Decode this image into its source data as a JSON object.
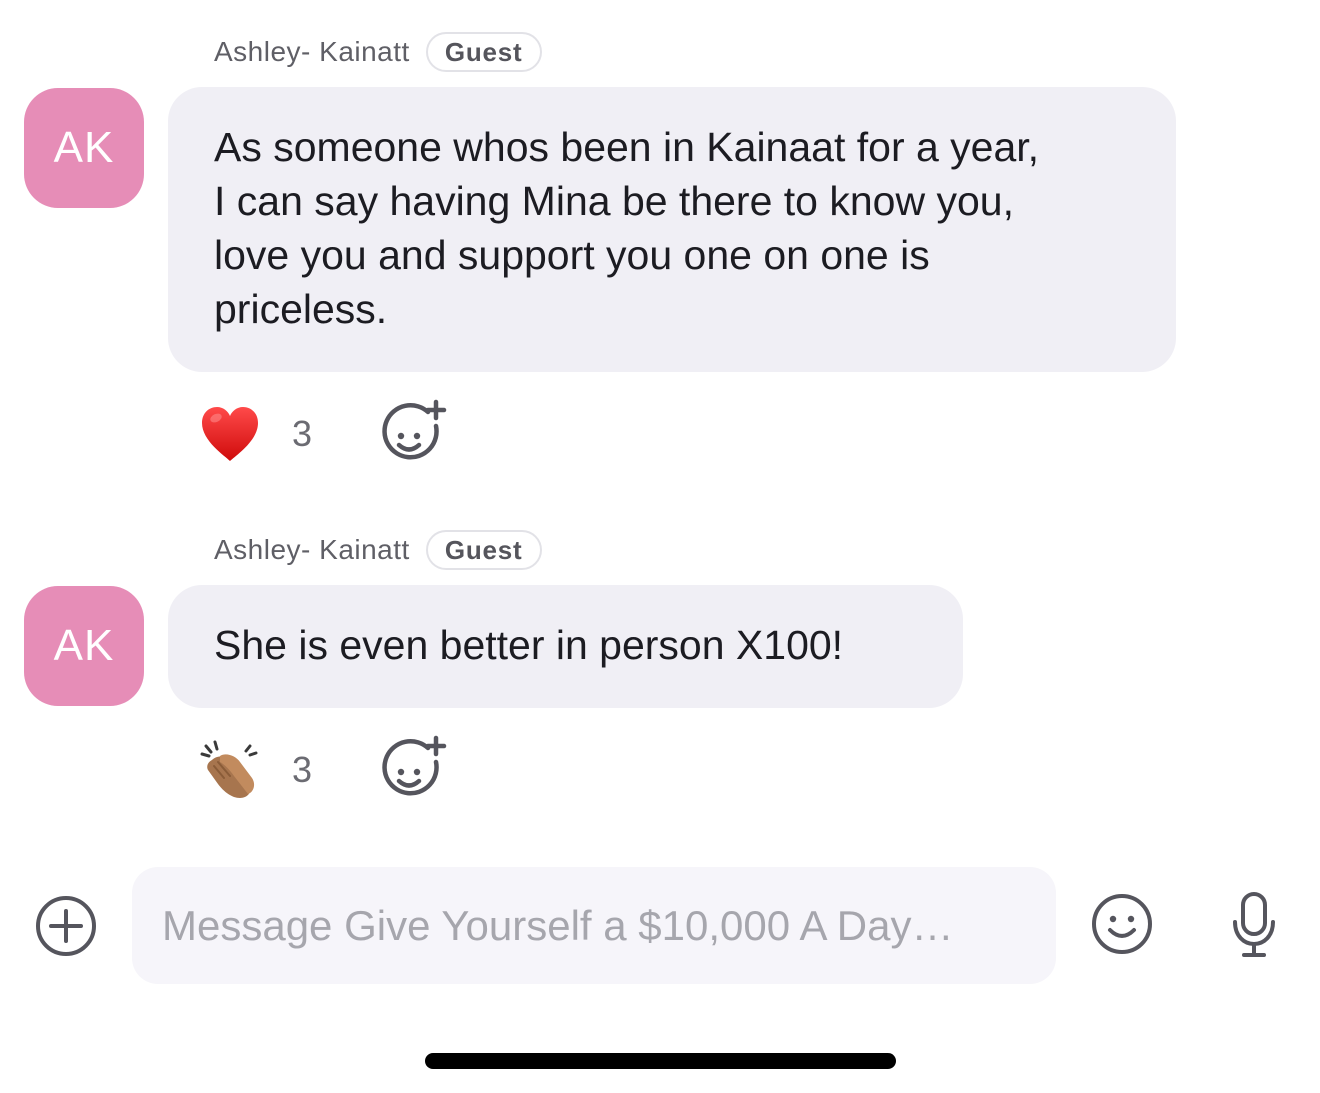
{
  "messages": [
    {
      "sender": "Ashley- Kainatt",
      "badge": "Guest",
      "avatar_initials": "AK",
      "text_lines": [
        "As someone whos been in Kainaat for a year,",
        "I can say having Mina be there to know you,",
        "love you and support you one on one is",
        "priceless."
      ],
      "reaction": {
        "emoji": "heart-emoji",
        "count": "3"
      }
    },
    {
      "sender": "Ashley- Kainatt",
      "badge": "Guest",
      "avatar_initials": "AK",
      "text_lines": [
        "She is even better in person X100!"
      ],
      "reaction": {
        "emoji": "clapping-hands-emoji",
        "count": "3"
      }
    }
  ],
  "composer": {
    "placeholder": "Message Give Yourself a $10,000 A Day…",
    "icons": [
      "plus-circle-icon",
      "smiley-icon",
      "microphone-icon"
    ]
  },
  "colors": {
    "avatar": "#e68db7",
    "bubble": "#f0eff5",
    "composer": "#f6f5fa",
    "icon": "#55555d"
  }
}
